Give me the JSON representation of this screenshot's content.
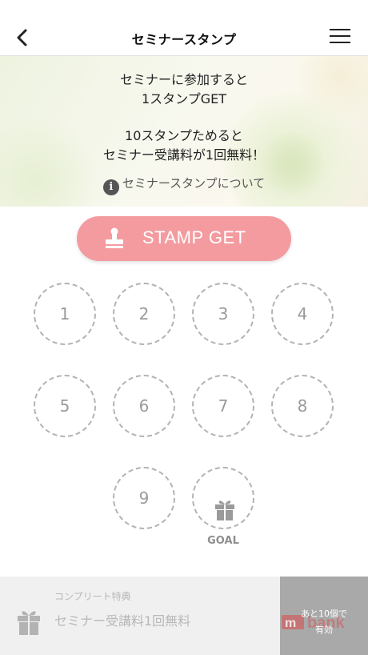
{
  "header": {
    "title": "セミナースタンプ",
    "back_icon": "chevron-left-icon",
    "menu_icon": "hamburger-menu-icon"
  },
  "hero": {
    "line1": "セミナーに参加すると",
    "line2": "1スタンプGET",
    "line3": "10スタンプためると",
    "line4": "セミナー受講料が1回無料！",
    "info_icon": "i",
    "info_link": "セミナースタンプについて"
  },
  "stamp_button": {
    "label": "STAMP GET",
    "icon": "stamp-icon",
    "color": "#f49ba0"
  },
  "stamps": {
    "collected": 0,
    "total": 10,
    "slots": [
      "1",
      "2",
      "3",
      "4",
      "5",
      "6",
      "7",
      "8",
      "9"
    ],
    "goal_label": "GOAL",
    "goal_icon": "gift-icon"
  },
  "footer": {
    "caption": "コンプリート特典",
    "benefit": "セミナー受講料1回無料",
    "status_line1": "あと10個で",
    "status_line2": "有効",
    "gift_icon": "gift-icon",
    "watermark": "m bank"
  }
}
